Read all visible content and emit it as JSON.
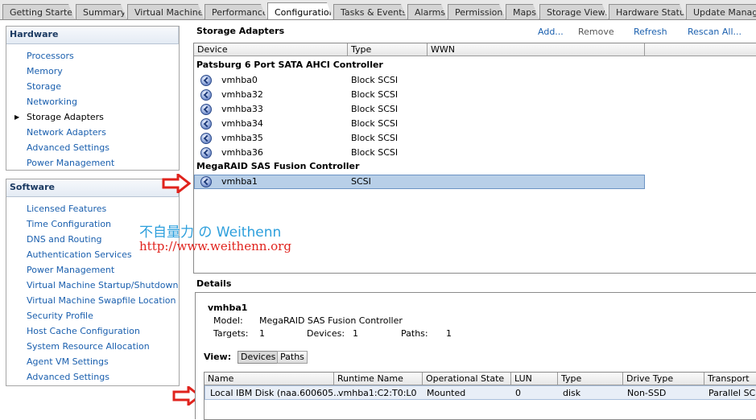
{
  "tabs": [
    {
      "label": "Getting Started",
      "active": false
    },
    {
      "label": "Summary",
      "active": false
    },
    {
      "label": "Virtual Machines",
      "active": false
    },
    {
      "label": "Performance",
      "active": false
    },
    {
      "label": "Configuration",
      "active": true
    },
    {
      "label": "Tasks & Events",
      "active": false
    },
    {
      "label": "Alarms",
      "active": false
    },
    {
      "label": "Permissions",
      "active": false
    },
    {
      "label": "Maps",
      "active": false
    },
    {
      "label": "Storage Views",
      "active": false
    },
    {
      "label": "Hardware Status",
      "active": false
    },
    {
      "label": "Update Manage",
      "active": false
    }
  ],
  "hardware": {
    "title": "Hardware",
    "items": [
      "Processors",
      "Memory",
      "Storage",
      "Networking",
      "Storage Adapters",
      "Network Adapters",
      "Advanced Settings",
      "Power Management"
    ],
    "current": "Storage Adapters"
  },
  "software": {
    "title": "Software",
    "items": [
      "Licensed Features",
      "Time Configuration",
      "DNS and Routing",
      "Authentication Services",
      "Power Management",
      "Virtual Machine Startup/Shutdown",
      "Virtual Machine Swapfile Location",
      "Security Profile",
      "Host Cache Configuration",
      "System Resource Allocation",
      "Agent VM Settings",
      "Advanced Settings"
    ]
  },
  "storage_adapters": {
    "title": "Storage Adapters",
    "actions": {
      "add": "Add...",
      "remove": "Remove",
      "refresh": "Refresh",
      "rescan": "Rescan All..."
    },
    "columns": [
      "Device",
      "Type",
      "WWN"
    ],
    "groups": [
      {
        "name": "Patsburg 6 Port SATA AHCI Controller",
        "adapters": [
          {
            "device": "vmhba0",
            "type": "Block SCSI"
          },
          {
            "device": "vmhba32",
            "type": "Block SCSI"
          },
          {
            "device": "vmhba33",
            "type": "Block SCSI"
          },
          {
            "device": "vmhba34",
            "type": "Block SCSI"
          },
          {
            "device": "vmhba35",
            "type": "Block SCSI"
          },
          {
            "device": "vmhba36",
            "type": "Block SCSI"
          }
        ]
      },
      {
        "name": "MegaRAID SAS Fusion Controller",
        "adapters": [
          {
            "device": "vmhba1",
            "type": "SCSI",
            "selected": true
          }
        ]
      }
    ]
  },
  "watermark": {
    "line1": "不自量力 の Weithenn",
    "line2": "http://www.weithenn.org"
  },
  "details": {
    "title": "Details",
    "name": "vmhba1",
    "model_label": "Model:",
    "model": "MegaRAID SAS Fusion Controller",
    "targets_label": "Targets:",
    "targets": "1",
    "devices_label": "Devices:",
    "devices": "1",
    "paths_label": "Paths:",
    "paths": "1",
    "view_label": "View:",
    "view_devices": "Devices",
    "view_paths": "Paths",
    "columns": [
      "Name",
      "Runtime Name",
      "Operational State",
      "LUN",
      "Type",
      "Drive Type",
      "Transport"
    ],
    "row": [
      "Local IBM Disk (naa.600605...",
      "vmhba1:C2:T0:L0",
      "Mounted",
      "0",
      "disk",
      "Non-SSD",
      "Parallel SC"
    ]
  },
  "colors": {
    "link": "#1a5fae",
    "selected_row": "#b8cfe8",
    "arrow": "#e0231d",
    "watermark_blue": "#2d9fdc",
    "watermark_red": "#e0231d"
  }
}
